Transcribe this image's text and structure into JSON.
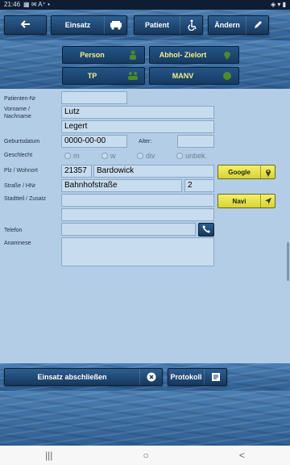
{
  "status_bar": {
    "time": "21:46",
    "right_icons": "◈ ▾ ▮"
  },
  "top_nav": {
    "back_icon": "arrow-left-icon",
    "einsatz_label": "Einsatz",
    "patient_label": "Patient",
    "aendern_label": "Ändern"
  },
  "sub_nav": {
    "person_label": "Person",
    "abhol_label": "Abhol- Zielort",
    "tp_label": "TP",
    "manv_label": "MANV"
  },
  "form": {
    "patienten_nr_label": "Patienten-Nr",
    "patienten_nr_value": "",
    "name_label_1": "Vorname /",
    "name_label_2": "Nachname",
    "vorname_value": "Lutz",
    "nachname_value": "Legert",
    "geburtsdatum_label": "Geburtsdatum",
    "geburtsdatum_value": "0000-00-00",
    "alter_label": "Alter:",
    "alter_value": "",
    "geschlecht_label": "Geschlecht",
    "gender_options": [
      "m",
      "w",
      "div",
      "unbek."
    ],
    "plz_label": "Plz / Wohnort",
    "plz_value": "21357",
    "ort_value": "Bardowick",
    "strasse_label": "Straße / HNr",
    "strasse_value": "Bahnhofstraße",
    "hnr_value": "2",
    "stadtteil_label": "Stadtteil / Zusatz",
    "stadtteil_value": "",
    "zusatz_value": "",
    "telefon_label": "Telefon",
    "telefon_value": "",
    "anamnese_label": "Anamnese",
    "anamnese_value": "",
    "google_label": "Google",
    "navi_label": "Navi"
  },
  "bottom": {
    "abschliessen_label": "Einsatz abschließen",
    "protokoll_label": "Protokoll"
  },
  "system_nav": {
    "recents": "|||",
    "home": "○",
    "back": "<"
  }
}
